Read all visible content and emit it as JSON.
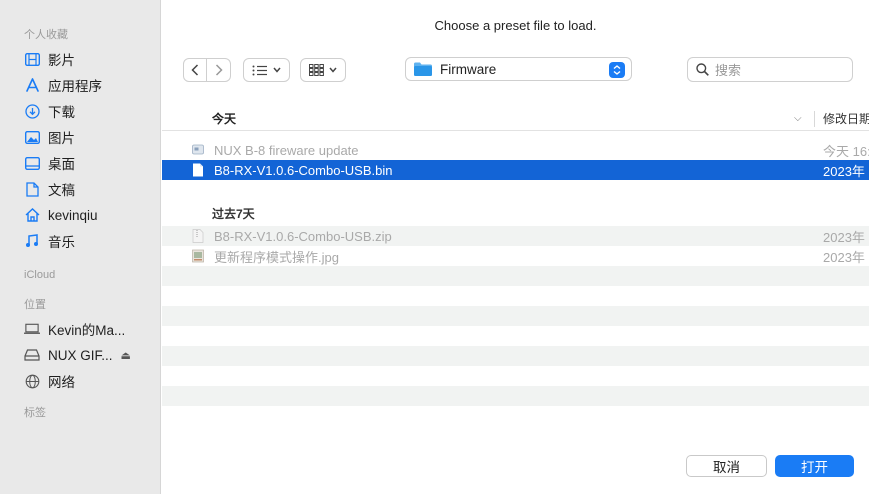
{
  "dialog": {
    "title": "Choose a preset file to load."
  },
  "sidebar": {
    "favorites_header": "个人收藏",
    "favorites": [
      {
        "label": "影片",
        "icon": "film-icon"
      },
      {
        "label": "应用程序",
        "icon": "applications-icon"
      },
      {
        "label": "下载",
        "icon": "download-icon"
      },
      {
        "label": "图片",
        "icon": "photo-icon"
      },
      {
        "label": "桌面",
        "icon": "desktop-icon"
      },
      {
        "label": "文稿",
        "icon": "document-icon"
      },
      {
        "label": "kevinqiu",
        "icon": "home-icon"
      },
      {
        "label": "音乐",
        "icon": "music-icon"
      }
    ],
    "icloud_header": "iCloud",
    "locations_header": "位置",
    "locations": [
      {
        "label": "Kevin的Ma...",
        "icon": "laptop-icon"
      },
      {
        "label": "NUX GIF...",
        "icon": "drive-icon"
      },
      {
        "label": "网络",
        "icon": "network-icon"
      }
    ],
    "tags_header": "标签"
  },
  "toolbar": {
    "current_folder": "Firmware",
    "search_placeholder": "搜索"
  },
  "columns": {
    "name": "今天",
    "date": "修改日期"
  },
  "groups": [
    {
      "label": "今天",
      "files": [
        {
          "name": "NUX B-8 fireware update",
          "date": "今天 16:",
          "state": "dim",
          "icon": "app-icon"
        },
        {
          "name": "B8-RX-V1.0.6-Combo-USB.bin",
          "date": "2023年",
          "state": "selected",
          "icon": "file-icon"
        }
      ]
    },
    {
      "label": "过去7天",
      "files": [
        {
          "name": "B8-RX-V1.0.6-Combo-USB.zip",
          "date": "2023年",
          "state": "dim",
          "icon": "zip-icon"
        },
        {
          "name": "更新程序模式操作.jpg",
          "date": "2023年",
          "state": "dim",
          "icon": "image-icon"
        }
      ]
    }
  ],
  "buttons": {
    "cancel": "取消",
    "open": "打开"
  },
  "colors": {
    "accent": "#1a7cf5",
    "selection": "#1364d6",
    "sidebar_bg": "#e9e9e9"
  }
}
